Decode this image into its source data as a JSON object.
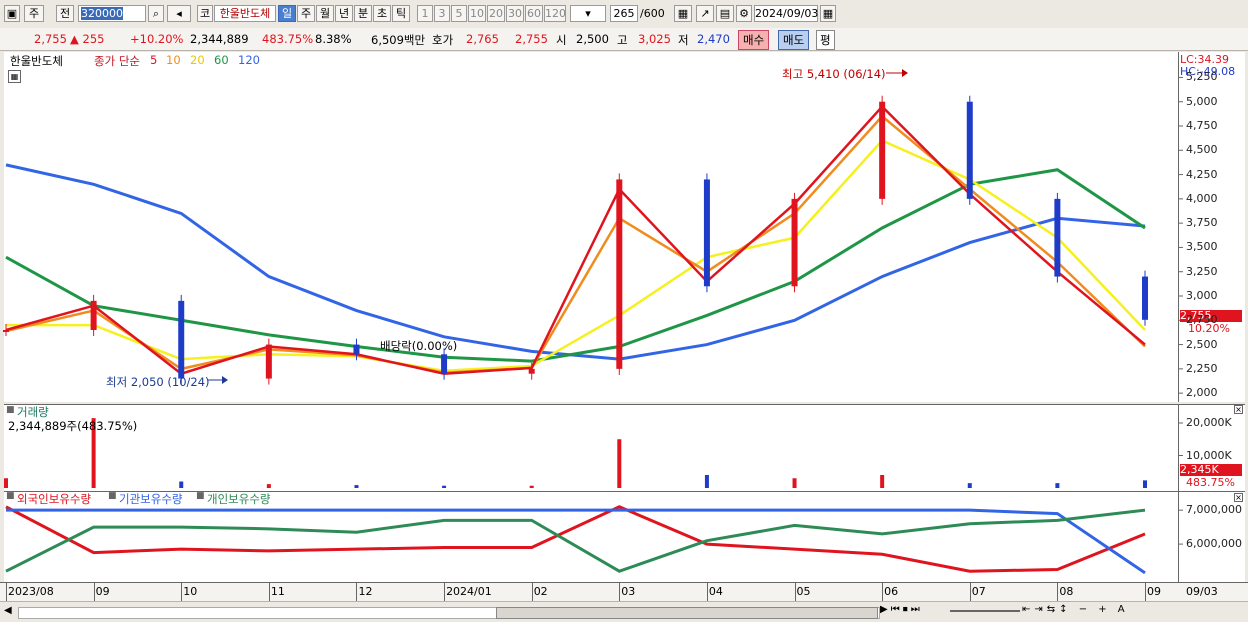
{
  "toolbar": {
    "market": "주",
    "prev": "전",
    "code": "320000",
    "name_prefix": "코",
    "stock_name": "한울반도체",
    "periods": [
      "일",
      "주",
      "월",
      "년",
      "분",
      "초",
      "틱"
    ],
    "minutes": [
      "1",
      "3",
      "5",
      "10",
      "20",
      "30",
      "60",
      "120"
    ],
    "count": "265",
    "count_max": "/600",
    "date": "2024/09/03"
  },
  "quote": {
    "price": "2,755",
    "change": "▲ 255",
    "rate": "+10.20%",
    "volume": "2,344,889",
    "vol_rate": "483.75%",
    "turnover": "8.38%",
    "amount": "6,509백만",
    "hoga_label": "호가",
    "ask": "2,765",
    "bid": "2,755",
    "open_label": "시",
    "open": "2,500",
    "high_label": "고",
    "high": "3,025",
    "low_label": "저",
    "low": "2,470",
    "buy": "매수",
    "sell": "매도",
    "avg": "평"
  },
  "price_panel": {
    "title": "한울반도체",
    "ma_label": "종가 단순",
    "ma_periods": [
      "5",
      "10",
      "20",
      "60",
      "120"
    ],
    "lc": "LC:34.39",
    "hc": "HC:-49.08",
    "high_note": "최고 5,410 (06/14)",
    "low_note": "최저 2,050 (10/24)",
    "div_note": "배당락(0.00%)",
    "last_price": "2,755",
    "last_rate": "10.20%",
    "ticks": [
      "5,250",
      "5,000",
      "4,750",
      "4,500",
      "4,250",
      "4,000",
      "3,750",
      "3,500",
      "3,250",
      "3,000",
      "2,750",
      "2,500",
      "2,250",
      "2,000"
    ]
  },
  "volume_panel": {
    "title": "거래량",
    "note": "2,344,889주(483.75%)",
    "ticks": [
      "20,000K",
      "10,000K"
    ],
    "last": "2,345K",
    "last_rate": "483.75%"
  },
  "holdings_panel": {
    "series_names": [
      "외국인보유수량",
      "기관보유수량",
      "개인보유수량"
    ],
    "ticks": [
      "7,000,000",
      "6,000,000"
    ]
  },
  "x_labels": [
    "2023/08",
    "09",
    "10",
    "11",
    "12",
    "2024/01",
    "02",
    "03",
    "04",
    "05",
    "06",
    "07",
    "08",
    "09",
    "09/03"
  ],
  "colors": {
    "up": "#E0141E",
    "down": "#1E3CC8",
    "ma5": "#E0141E",
    "ma10": "#F08C1E",
    "ma20": "#F5F01E",
    "ma60": "#1E9646",
    "ma120": "#3264E6",
    "foreign": "#E0141E",
    "inst": "#3264E6",
    "indiv": "#2E8B57"
  },
  "chart_data": {
    "type": "line",
    "title": "한울반도체",
    "x": [
      "2023/08",
      "09",
      "10",
      "11",
      "12",
      "2024/01",
      "02",
      "03",
      "04",
      "05",
      "06",
      "07",
      "08",
      "09"
    ],
    "series": [
      {
        "name": "종가",
        "values": [
          2650,
          2950,
          2150,
          2500,
          2400,
          2200,
          2250,
          4200,
          3100,
          4000,
          5000,
          4000,
          3200,
          2755
        ]
      },
      {
        "name": "5",
        "values": [
          2650,
          2900,
          2200,
          2480,
          2400,
          2200,
          2260,
          4100,
          3150,
          3950,
          4950,
          4050,
          3250,
          2500
        ]
      },
      {
        "name": "10",
        "values": [
          2640,
          2850,
          2250,
          2450,
          2390,
          2210,
          2260,
          3800,
          3250,
          3850,
          4850,
          4100,
          3350,
          2480
        ]
      },
      {
        "name": "20",
        "values": [
          2700,
          2700,
          2350,
          2400,
          2380,
          2230,
          2280,
          2800,
          3400,
          3600,
          4600,
          4200,
          3600,
          2650
        ]
      },
      {
        "name": "60",
        "values": [
          3400,
          2900,
          2750,
          2600,
          2480,
          2370,
          2330,
          2480,
          2800,
          3150,
          3700,
          4150,
          4300,
          3700
        ]
      },
      {
        "name": "120",
        "values": [
          4350,
          4150,
          3850,
          3200,
          2850,
          2580,
          2430,
          2350,
          2500,
          2750,
          3200,
          3550,
          3800,
          3720
        ]
      }
    ],
    "ylim": [
      1950,
      5450
    ],
    "volume_K": [
      3000,
      21500,
      2000,
      1200,
      900,
      700,
      700,
      15000,
      4000,
      3000,
      4000,
      1500,
      1500,
      2345
    ],
    "holdings": [
      {
        "name": "외국인보유수량",
        "values": [
          7100000,
          5750000,
          5850000,
          5800000,
          5850000,
          5900000,
          5900000,
          7100000,
          6000000,
          5850000,
          5700000,
          5200000,
          5250000,
          6300000
        ]
      },
      {
        "name": "기관보유수량",
        "values": [
          7000000,
          7000000,
          7000000,
          7000000,
          7000000,
          7000000,
          7000000,
          7000000,
          7000000,
          7000000,
          7000000,
          7000000,
          6900000,
          5150000
        ]
      },
      {
        "name": "개인보유수량",
        "values": [
          5200000,
          6500000,
          6500000,
          6450000,
          6350000,
          6700000,
          6700000,
          5200000,
          6100000,
          6550000,
          6300000,
          6600000,
          6700000,
          7000000
        ]
      }
    ]
  }
}
